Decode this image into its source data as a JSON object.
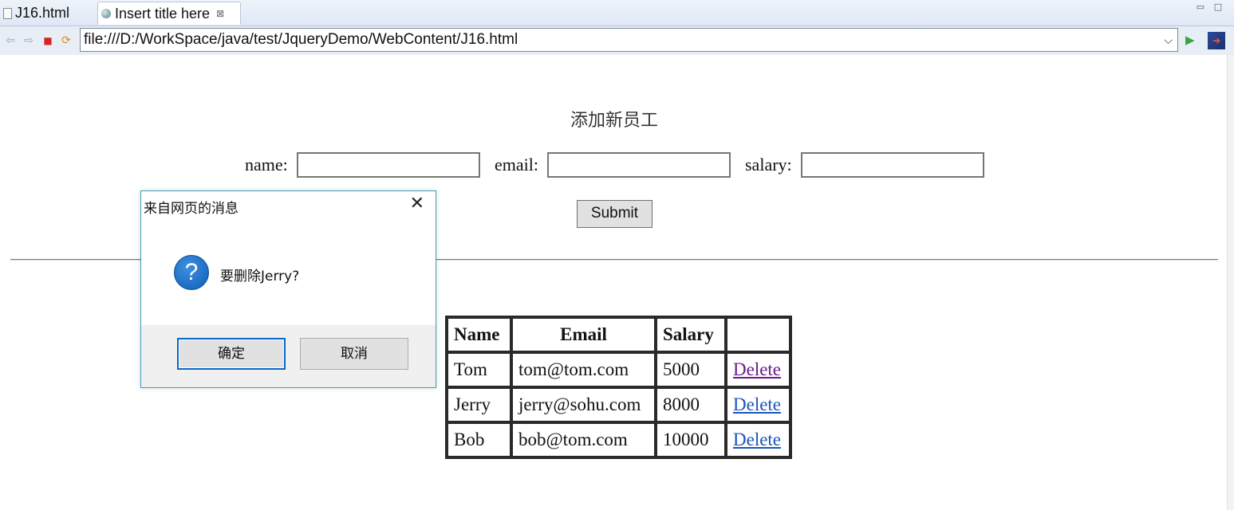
{
  "tabs": [
    {
      "label": "J16.html",
      "active": false
    },
    {
      "label": "Insert title here",
      "active": true
    }
  ],
  "tab_close_glyph": "⊠",
  "address_bar": {
    "url": "file:///D:/WorkSpace/java/test/JqueryDemo/WebContent/J16.html"
  },
  "page": {
    "heading": "添加新员工",
    "form": {
      "name_label": "name:",
      "email_label": "email:",
      "salary_label": "salary:",
      "name_value": "",
      "email_value": "",
      "salary_value": "",
      "submit_label": "Submit"
    },
    "table": {
      "headers": [
        "Name",
        "Email",
        "Salary",
        ""
      ],
      "rows": [
        {
          "name": "Tom",
          "email": "tom@tom.com",
          "salary": "5000",
          "action": "Delete"
        },
        {
          "name": "Jerry",
          "email": "jerry@sohu.com",
          "salary": "8000",
          "action": "Delete"
        },
        {
          "name": "Bob",
          "email": "bob@tom.com",
          "salary": "10000",
          "action": "Delete"
        }
      ]
    }
  },
  "dialog": {
    "title": "来自网页的消息",
    "message": "要删除Jerry?",
    "ok_label": "确定",
    "cancel_label": "取消"
  },
  "colors": {
    "link": "#1a55b8",
    "visited_link": "#6a1a8a",
    "dialog_border": "#3aa0b8",
    "dialog_default_button": "#0b66c7",
    "question_icon": "#0d5fb7"
  }
}
